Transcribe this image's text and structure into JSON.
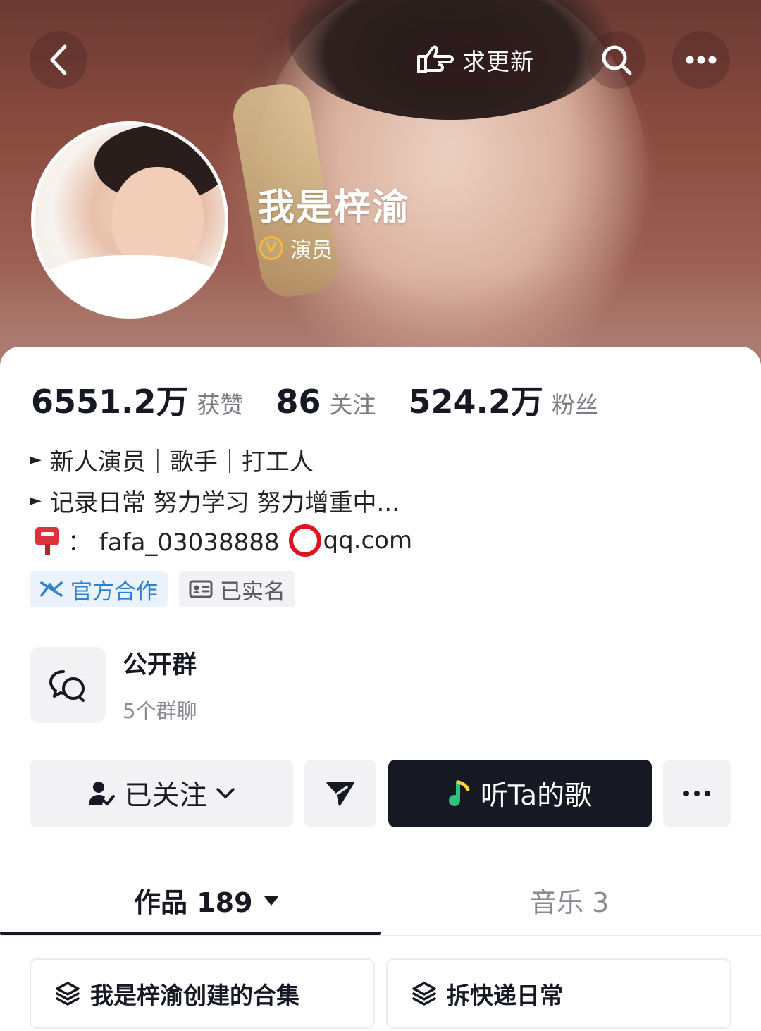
{
  "header": {
    "back_icon": "chevron-left-icon",
    "update_label": "求更新",
    "update_icon": "hand-point-icon",
    "search_icon": "search-icon",
    "more_icon": "more-dots-icon"
  },
  "profile": {
    "name": "我是梓渝",
    "verify_badge": "V",
    "verify_label": "演员",
    "verify_color": "#f5b93a"
  },
  "stats": [
    {
      "value": "6551.2万",
      "label": "获赞"
    },
    {
      "value": "86",
      "label": "关注"
    },
    {
      "value": "524.2万",
      "label": "粉丝"
    }
  ],
  "bio": {
    "line1": "新人演员｜歌手｜打工人",
    "line2": "记录日常 努力学习 努力增重中...",
    "line3_prefix": "：  fafa_03038888",
    "line3_suffix": "qq.com",
    "line3_icon": "mailbox-icon"
  },
  "tags": [
    {
      "label": "官方合作",
      "icon": "official-coop-icon",
      "color": "#2f7fd1"
    },
    {
      "label": "已实名",
      "icon": "id-card-icon",
      "color": "#5a5a62"
    }
  ],
  "group": {
    "title": "公开群",
    "subtitle": "5个群聊",
    "icon": "chat-bubbles-icon"
  },
  "actions": {
    "followed_label": "已关注",
    "music_label": "听Ta的歌",
    "music_bg": "#161823"
  },
  "tabs": {
    "works_label": "作品 189",
    "music_label": "音乐 3"
  },
  "collections": [
    {
      "label": "我是梓渝创建的合集"
    },
    {
      "label": "拆快递日常"
    }
  ]
}
